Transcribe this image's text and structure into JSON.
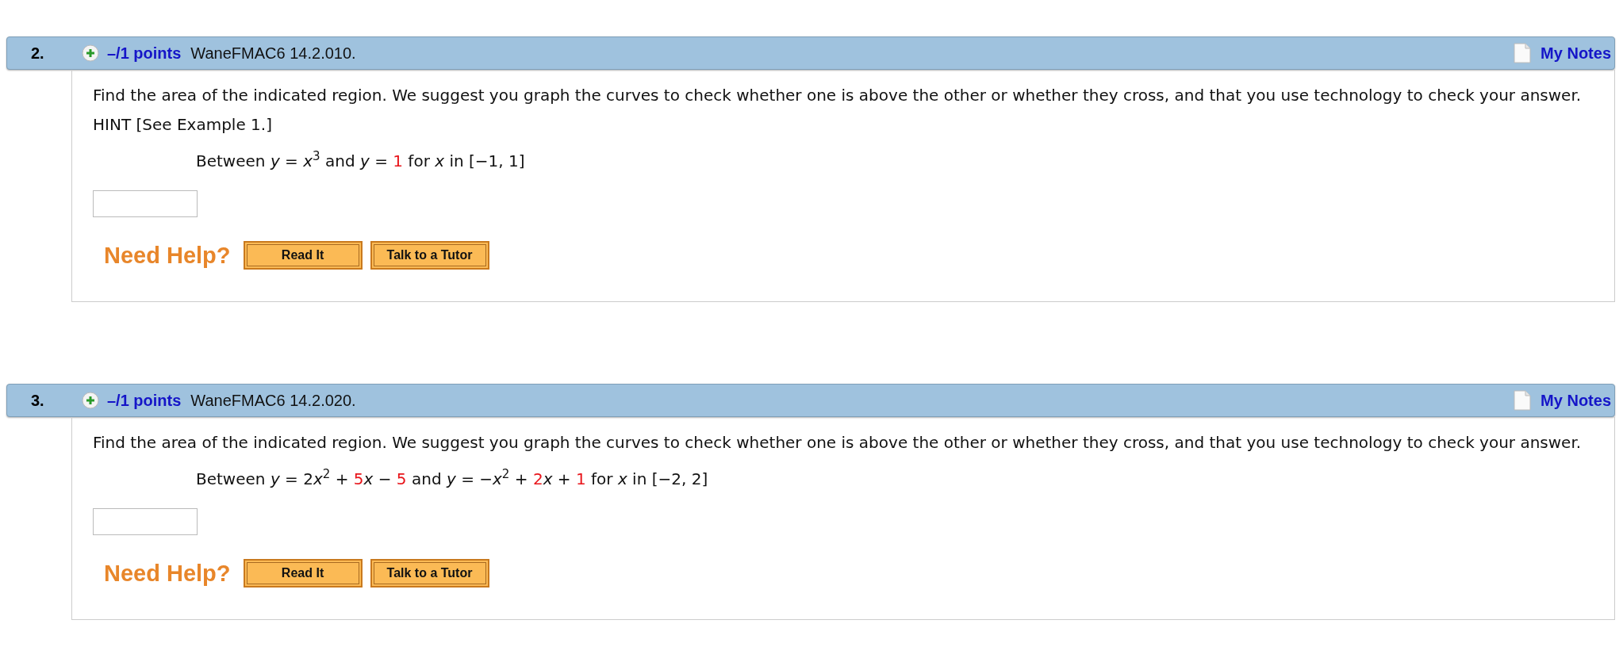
{
  "questions": [
    {
      "number": "2.",
      "points": "–/1 points",
      "source": "WaneFMAC6 14.2.010.",
      "notes_link": "My Notes",
      "prompt": "Find the area of the indicated region. We suggest you graph the curves to check whether one is above the other or whether they cross, and that you use technology to check your answer. HINT [See Example 1.]",
      "expression": [
        {
          "kind": "text",
          "text": "Between "
        },
        {
          "kind": "var",
          "text": "y"
        },
        {
          "kind": "text",
          "text": " = "
        },
        {
          "kind": "var",
          "text": "x"
        },
        {
          "kind": "sup",
          "text": "3"
        },
        {
          "kind": "text",
          "text": " and "
        },
        {
          "kind": "var",
          "text": "y"
        },
        {
          "kind": "text",
          "text": " = "
        },
        {
          "kind": "red",
          "text": "1"
        },
        {
          "kind": "text",
          "text": " for "
        },
        {
          "kind": "var",
          "text": "x"
        },
        {
          "kind": "text",
          "text": " in [−1, 1]"
        }
      ],
      "help_label": "Need Help?",
      "buttons": [
        "Read It",
        "Talk to a Tutor"
      ]
    },
    {
      "number": "3.",
      "points": "–/1 points",
      "source": "WaneFMAC6 14.2.020.",
      "notes_link": "My Notes",
      "prompt": "Find the area of the indicated region. We suggest you graph the curves to check whether one is above the other or whether they cross, and that you use technology to check your answer.",
      "expression": [
        {
          "kind": "text",
          "text": "Between "
        },
        {
          "kind": "var",
          "text": "y"
        },
        {
          "kind": "text",
          "text": " = 2"
        },
        {
          "kind": "var",
          "text": "x"
        },
        {
          "kind": "sup",
          "text": "2"
        },
        {
          "kind": "text",
          "text": " + "
        },
        {
          "kind": "red",
          "text": "5"
        },
        {
          "kind": "var",
          "text": "x"
        },
        {
          "kind": "text",
          "text": " − "
        },
        {
          "kind": "red",
          "text": "5"
        },
        {
          "kind": "text",
          "text": " and "
        },
        {
          "kind": "var",
          "text": "y"
        },
        {
          "kind": "text",
          "text": " = −"
        },
        {
          "kind": "var",
          "text": "x"
        },
        {
          "kind": "sup",
          "text": "2"
        },
        {
          "kind": "text",
          "text": " + "
        },
        {
          "kind": "red",
          "text": "2"
        },
        {
          "kind": "var",
          "text": "x"
        },
        {
          "kind": "text",
          "text": " + "
        },
        {
          "kind": "red",
          "text": "1"
        },
        {
          "kind": "text",
          "text": " for "
        },
        {
          "kind": "var",
          "text": "x"
        },
        {
          "kind": "text",
          "text": " in [−2, 2]"
        }
      ],
      "help_label": "Need Help?",
      "buttons": [
        "Read It",
        "Talk to a Tutor"
      ]
    }
  ]
}
